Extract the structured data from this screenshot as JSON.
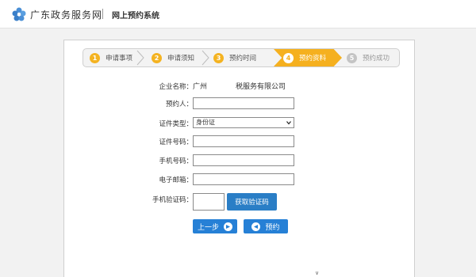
{
  "header": {
    "brand": "广东政务服务网",
    "system_name": "网上预约系统"
  },
  "steps": [
    {
      "num": "1",
      "label": "申请事项",
      "state": "done"
    },
    {
      "num": "2",
      "label": "申请须知",
      "state": "done"
    },
    {
      "num": "3",
      "label": "预约时间",
      "state": "done"
    },
    {
      "num": "4",
      "label": "预约资料",
      "state": "active"
    },
    {
      "num": "5",
      "label": "预约成功",
      "state": "pending"
    }
  ],
  "form": {
    "company_label": "企业名称：",
    "company_value_left": "广州",
    "company_value_right": "税服务有限公司",
    "booker_label": "预约人：",
    "booker_value": "",
    "id_type_label": "证件类型：",
    "id_type_selected": "身份证",
    "id_number_label": "证件号码：",
    "id_number_value": "",
    "phone_label": "手机号码：",
    "phone_value": "",
    "email_label": "电子邮箱：",
    "email_value": "",
    "sms_code_label": "手机验证码：",
    "sms_code_value": "",
    "get_code_label": "获取验证码"
  },
  "actions": {
    "prev_label": "上一步",
    "submit_label": "预约"
  },
  "colors": {
    "accent_orange": "#f5b01f",
    "button_blue": "#2680d6"
  },
  "icons": {
    "logo": "guangdong-flower-logo",
    "select_arrow": "chevron-down-icon",
    "prev": "arrow-right-circle-icon",
    "submit": "arrow-left-circle-icon"
  },
  "footer_mark": "∨"
}
